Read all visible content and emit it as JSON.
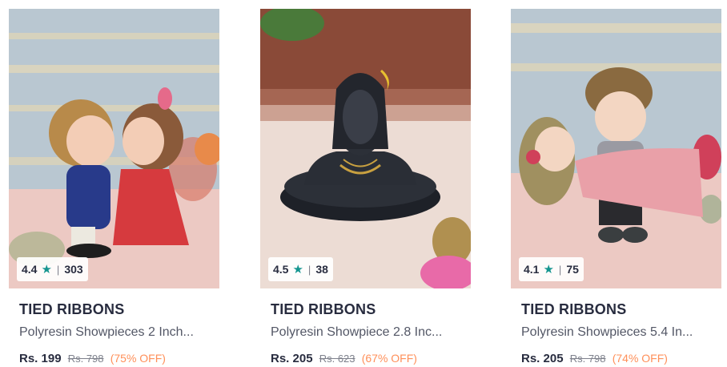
{
  "products": [
    {
      "rating": "4.4",
      "rating_count": "303",
      "brand": "TIED RIBBONS",
      "title": "Polyresin Showpieces 2 Inch...",
      "price": "Rs. 199",
      "mrp": "Rs. 798",
      "discount": "(75% OFF)"
    },
    {
      "rating": "4.5",
      "rating_count": "38",
      "brand": "TIED RIBBONS",
      "title": "Polyresin Showpiece 2.8 Inc...",
      "price": "Rs. 205",
      "mrp": "Rs. 623",
      "discount": "(67% OFF)"
    },
    {
      "rating": "4.1",
      "rating_count": "75",
      "brand": "TIED RIBBONS",
      "title": "Polyresin Showpieces 5.4 In...",
      "price": "Rs. 205",
      "mrp": "Rs. 798",
      "discount": "(74% OFF)"
    }
  ],
  "icons": {
    "rating_star": "star-icon"
  },
  "colors": {
    "star": "#14958f",
    "discount": "#ff905a",
    "text": "#282c3f"
  }
}
